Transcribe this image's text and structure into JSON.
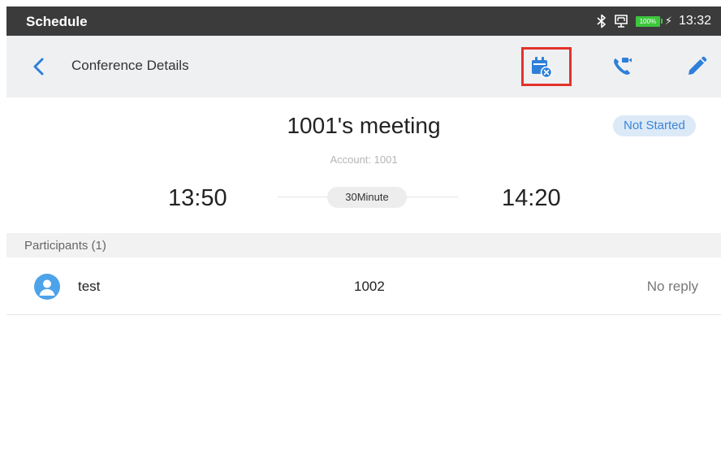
{
  "status_bar": {
    "app_title": "Schedule",
    "time": "13:32",
    "battery": "100%"
  },
  "app_bar": {
    "title": "Conference Details",
    "actions": {
      "cancel": "cancel-meeting",
      "call": "video-call",
      "edit": "edit"
    }
  },
  "meeting": {
    "title": "1001's meeting",
    "status": "Not Started",
    "account": "Account: 1001",
    "start": "13:50",
    "end": "14:20",
    "duration": "30Minute"
  },
  "participants": {
    "header": "Participants (1)",
    "items": [
      {
        "name": "test",
        "number": "1002",
        "reply": "No reply"
      }
    ]
  },
  "colors": {
    "accent": "#3b86d8",
    "highlight": "#e3322b",
    "status_bar": "#3b3b3b",
    "app_bar": "#eef0f2"
  }
}
